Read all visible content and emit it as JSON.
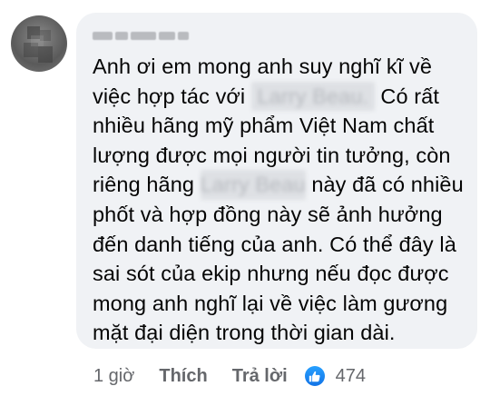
{
  "comment": {
    "author": "",
    "lines": [
      [
        "Anh ơi em mong anh suy nghĩ kĩ về"
      ],
      [
        "việc hợp tác với ",
        "{blur}",
        " Có rất"
      ],
      [
        "nhiều hãng mỹ phẩm Việt Nam chất"
      ],
      [
        "lượng được mọi người tin tưởng, còn"
      ],
      [
        "riêng hãng ",
        "{blur}",
        " này đã có nhiều"
      ],
      [
        "phốt và hợp đồng này sẽ ảnh hưởng"
      ],
      [
        "đến danh tiếng của anh. Có thể đây là"
      ],
      [
        "sai sót của ekip nhưng nếu đọc được"
      ],
      [
        "mong anh nghĩ lại về việc làm gương"
      ],
      [
        "mặt đại diện trong thời gian dài."
      ]
    ],
    "line1": "Anh ơi em mong anh suy nghĩ kĩ về",
    "line2_before": "việc hợp tác với",
    "line2_after": "Có rất",
    "line3": "nhiều hãng mỹ phẩm Việt Nam chất",
    "line4": "lượng được mọi người tin tưởng, còn",
    "line5_before": "riêng hãng",
    "line5_after": "này đã có nhiều",
    "line6": "phốt và hợp đồng này sẽ ảnh hưởng",
    "line7": "đến danh tiếng của anh. Có thể đây là",
    "line8": "sai sót của ekip nhưng nếu đọc được",
    "line9": "mong anh nghĩ lại về việc làm gương",
    "line10": "mặt đại diện trong thời gian dài."
  },
  "actions": {
    "time": "1 giờ",
    "like_label": "Thích",
    "reply_label": "Trả lời",
    "reaction_icon": "thumbs-up-icon",
    "reaction_count": "474",
    "like_color": "#1877f2"
  },
  "colors": {
    "bubble_bg": "#f0f2f5",
    "text": "#050505",
    "secondary": "#65676b"
  }
}
